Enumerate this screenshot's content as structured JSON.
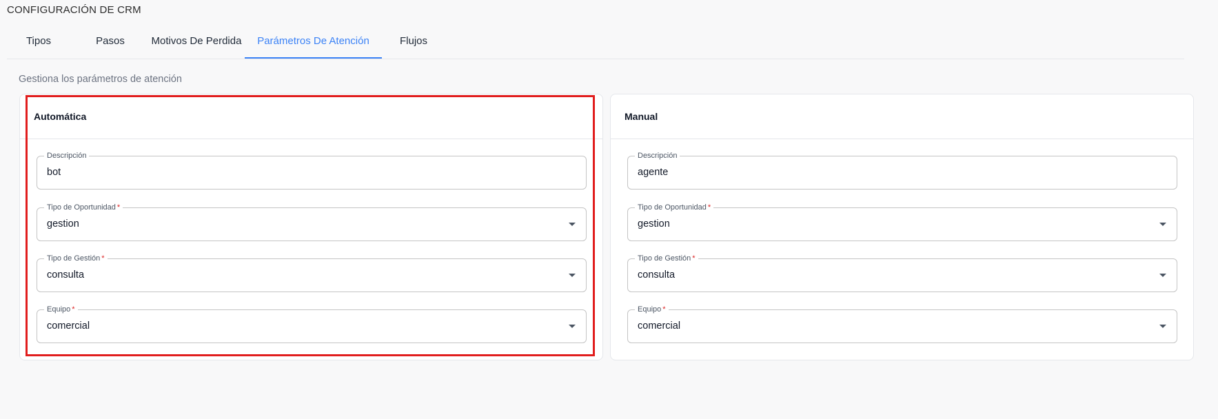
{
  "page": {
    "title": "CONFIGURACIÓN DE CRM",
    "subtitle": "Gestiona los parámetros de atención"
  },
  "tabs": [
    {
      "label": "Tipos",
      "active": false
    },
    {
      "label": "Pasos",
      "active": false
    },
    {
      "label": "Motivos De Perdida",
      "active": false
    },
    {
      "label": "Parámetros De Atención",
      "active": true
    },
    {
      "label": "Flujos",
      "active": false
    }
  ],
  "cards": [
    {
      "title": "Automática",
      "fields": {
        "descripcion": {
          "label": "Descripción",
          "value": "bot"
        },
        "tipo_oportunidad": {
          "label": "Tipo de Oportunidad",
          "required": "*",
          "value": "gestion"
        },
        "tipo_gestion": {
          "label": "Tipo de Gestión",
          "required": "*",
          "value": "consulta"
        },
        "equipo": {
          "label": "Equipo",
          "required": "*",
          "value": "comercial"
        }
      }
    },
    {
      "title": "Manual",
      "fields": {
        "descripcion": {
          "label": "Descripción",
          "value": "agente"
        },
        "tipo_oportunidad": {
          "label": "Tipo de Oportunidad",
          "required": "*",
          "value": "gestion"
        },
        "tipo_gestion": {
          "label": "Tipo de Gestión",
          "required": "*",
          "value": "consulta"
        },
        "equipo": {
          "label": "Equipo",
          "required": "*",
          "value": "comercial"
        }
      }
    }
  ],
  "colors": {
    "accent": "#3b82f6",
    "highlight": "#e11d1d",
    "required": "#dc2626"
  },
  "icons": {
    "dropdown": "caret-down-icon"
  }
}
